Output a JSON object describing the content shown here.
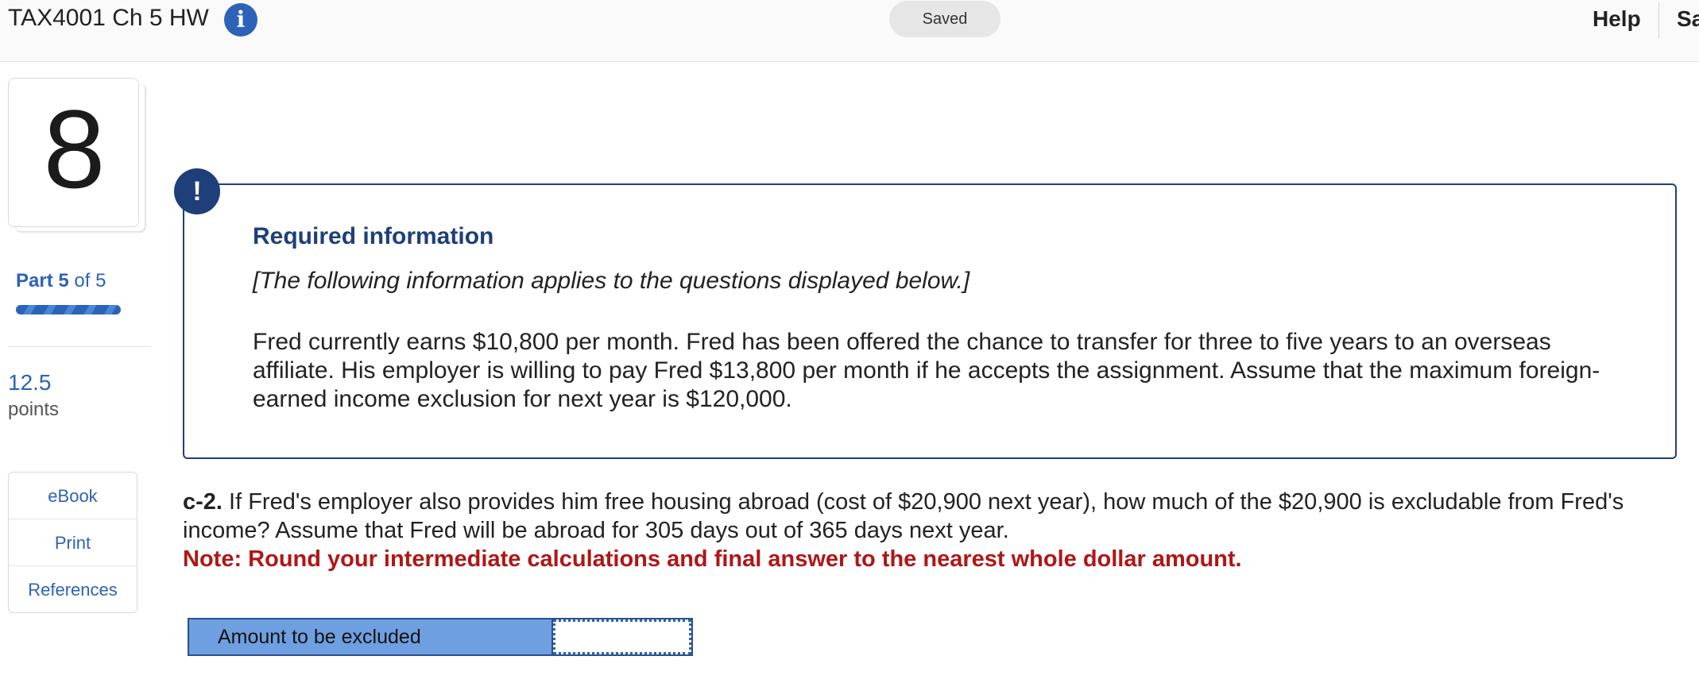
{
  "header": {
    "assignment_title": "TAX4001 Ch 5 HW",
    "info_icon": "i",
    "status": "Saved",
    "help": "Help",
    "save_partial": "Sa"
  },
  "question_panel": {
    "number": "8",
    "part_prefix": "Part",
    "part_current": "5",
    "part_suffix": "of 5",
    "progress_fraction": 1.0,
    "points_value": "12.5",
    "points_label": "points"
  },
  "resources": {
    "items": [
      "eBook",
      "Print",
      "References"
    ]
  },
  "required_info": {
    "alert_icon": "!",
    "title": "Required information",
    "subtitle": "[The following information applies to the questions displayed below.]",
    "body": "Fred currently earns $10,800 per month. Fred has been offered the chance to transfer for three to five years to an overseas affiliate. His employer is willing to pay Fred $13,800 per month if he accepts the assignment. Assume that the maximum foreign-earned income exclusion for next year is $120,000."
  },
  "question": {
    "label": "c-2.",
    "text": " If Fred's employer also provides him free housing abroad (cost of $20,900 next year), how much of the $20,900 is excludable from Fred's income? Assume that Fred will be abroad for 305 days out of 365 days next year.",
    "note": "Note: Round your intermediate calculations and final answer to the nearest whole dollar amount."
  },
  "answer": {
    "label": "Amount to be excluded",
    "value": ""
  },
  "colors": {
    "accent_blue": "#2c63b8",
    "navy": "#1e3f7a",
    "note_red": "#b01616",
    "answer_label_bg": "#6e9fe0"
  }
}
